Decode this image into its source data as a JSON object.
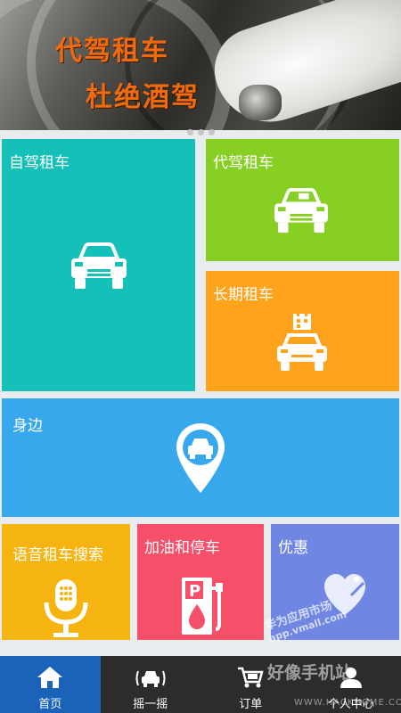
{
  "banner": {
    "slogan_line1": "代驾租车",
    "slogan_line2": "杜绝酒驾",
    "page_dots": 3
  },
  "tiles": {
    "self_drive": {
      "label": "自驾租车",
      "icon": "car-icon",
      "color": "#14c0b8"
    },
    "chauffeur": {
      "label": "代驾租车",
      "icon": "car-icon",
      "color": "#88cf24"
    },
    "long_term": {
      "label": "长期租车",
      "icon": "car-with-calendar-icon",
      "color": "#ffa21c"
    },
    "nearby": {
      "label": "身边",
      "icon": "location-pin-car-icon",
      "color": "#38a8ec"
    },
    "voice_search": {
      "label": "语音租车搜索",
      "icon": "microphone-icon",
      "color": "#f5b410"
    },
    "fuel_parking": {
      "label": "加油和停车",
      "icon": "fuel-pump-parking-icon",
      "color": "#f54f6a"
    },
    "promotions": {
      "label": "优惠",
      "icon": "heart-tag-icon",
      "color": "#6f86e3"
    }
  },
  "watermark": {
    "line1": "华为应用市场",
    "line2": "app.vmall.com",
    "site": "好像手机站",
    "url": "WWW.HACKHOME.COM"
  },
  "tabbar": {
    "items": [
      {
        "label": "首页",
        "icon": "home-icon",
        "active": true
      },
      {
        "label": "摇一摇",
        "icon": "shake-car-icon",
        "active": false
      },
      {
        "label": "订单",
        "icon": "cart-icon",
        "active": false
      },
      {
        "label": "个人中心",
        "icon": "user-icon",
        "active": false
      }
    ]
  }
}
